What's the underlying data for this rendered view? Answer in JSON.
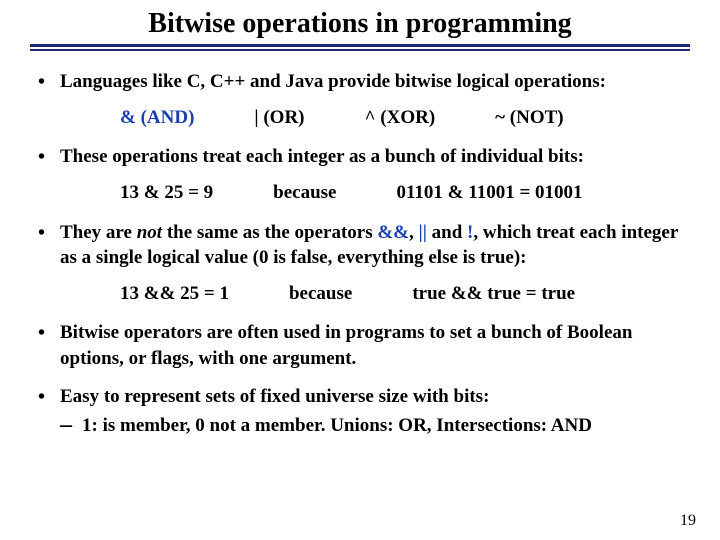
{
  "title": "Bitwise operations in programming",
  "bullets": {
    "b1": "Languages like C, C++ and Java provide bitwise logical operations:",
    "ops": {
      "and": "& (AND)",
      "or": "| (OR)",
      "xor": "^ (XOR)",
      "not": "~ (NOT)"
    },
    "b2": "These operations treat each integer as a bunch of individual bits:",
    "ex1": {
      "left": "13 & 25 = 9",
      "mid": "because",
      "right": "01101 & 11001 = 01001"
    },
    "b3a": "They are ",
    "b3not": "not",
    "b3b": " the same as the operators ",
    "b3ops1": "&&",
    "b3sep1": ", ",
    "b3ops2": "||",
    "b3sep2": " and ",
    "b3ops3": "!",
    "b3c": ", which treat each integer as a single logical value (0 is false, everything else is true):",
    "ex2": {
      "left": "13 && 25 = 1",
      "mid": "because",
      "right": "true && true = true"
    },
    "b4": "Bitwise operators are often used in programs to set a bunch of Boolean options, or flags, with one argument.",
    "b5": "Easy to represent sets of fixed universe size with bits:",
    "b5sub": "1: is member, 0 not a member. Unions: OR, Intersections: AND"
  },
  "page_number": "19"
}
